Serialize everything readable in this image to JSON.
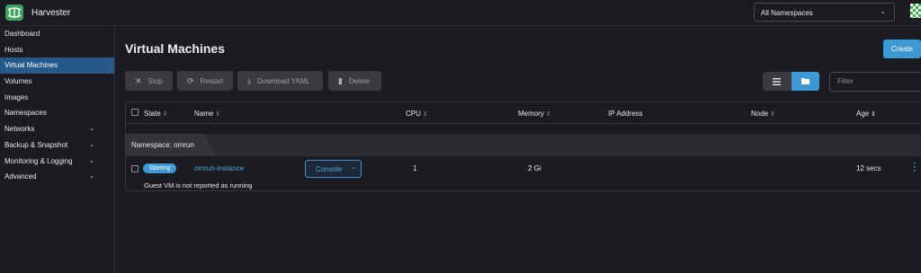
{
  "app": {
    "title": "Harvester"
  },
  "header": {
    "namespace_select": "All Namespaces"
  },
  "sidebar": {
    "items": [
      {
        "label": "Dashboard",
        "chevron": false,
        "active": false
      },
      {
        "label": "Hosts",
        "chevron": false,
        "active": false
      },
      {
        "label": "Virtual Machines",
        "chevron": false,
        "active": true
      },
      {
        "label": "Volumes",
        "chevron": false,
        "active": false
      },
      {
        "label": "Images",
        "chevron": false,
        "active": false
      },
      {
        "label": "Namespaces",
        "chevron": false,
        "active": false
      },
      {
        "label": "Networks",
        "chevron": true,
        "active": false
      },
      {
        "label": "Backup & Snapshot",
        "chevron": true,
        "active": false
      },
      {
        "label": "Monitoring & Logging",
        "chevron": true,
        "active": false
      },
      {
        "label": "Advanced",
        "chevron": true,
        "active": false
      }
    ]
  },
  "page": {
    "title": "Virtual Machines",
    "create_label": "Create"
  },
  "actions": {
    "stop": "Stop",
    "restart": "Restart",
    "download_yaml": "Download YAML",
    "delete": "Delete"
  },
  "filter": {
    "placeholder": "Filter"
  },
  "table": {
    "headers": {
      "state": "State",
      "name": "Name",
      "cpu": "CPU",
      "memory": "Memory",
      "ip": "IP Address",
      "node": "Node",
      "age": "Age"
    },
    "group_label": "Namespace: omrun",
    "rows": [
      {
        "state": "Starting",
        "name": "omrun-instance",
        "console": "Console",
        "cpu": "1",
        "memory": "2 Gi",
        "ip": "",
        "node": "",
        "age": "12 secs",
        "note": "Guest VM is not reported as running"
      }
    ]
  },
  "colors": {
    "accent": "#3d98d3",
    "active_nav": "#24598a",
    "brand": "#3ea463"
  }
}
